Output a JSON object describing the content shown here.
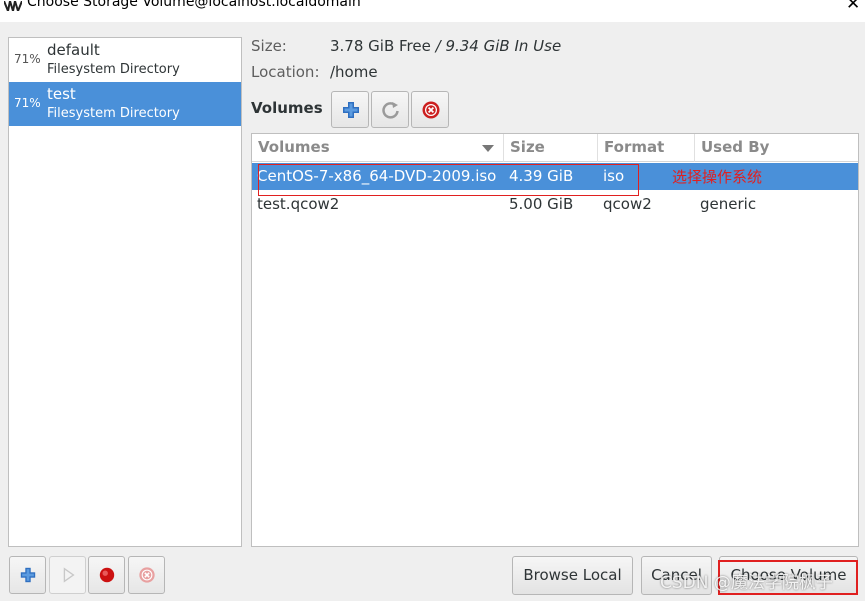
{
  "window": {
    "title": "Choose Storage Volume@localhost.localdomain",
    "close_icon": "close-icon"
  },
  "pools": [
    {
      "percent": "71%",
      "name": "default",
      "type": "Filesystem Directory",
      "selected": false
    },
    {
      "percent": "71%",
      "name": "test",
      "type": "Filesystem Directory",
      "selected": true
    }
  ],
  "pool_info": {
    "size_label": "Size:",
    "size_free": "3.78 GiB Free",
    "size_sep": " / ",
    "size_in_use": "9.34 GiB In Use",
    "location_label": "Location:",
    "location_value": "/home"
  },
  "volumes_toolbar": {
    "label": "Volumes",
    "buttons": [
      "add-volume",
      "refresh-volumes",
      "delete-volume"
    ]
  },
  "volumes_table": {
    "columns": [
      "Volumes",
      "Size",
      "Format",
      "Used By"
    ],
    "rows": [
      {
        "name": "CentOS-7-x86_64-DVD-2009.iso",
        "size": "4.39 GiB",
        "format": "iso",
        "used_by": "",
        "selected": true
      },
      {
        "name": "test.qcow2",
        "size": "5.00 GiB",
        "format": "qcow2",
        "used_by": "generic",
        "selected": false
      }
    ]
  },
  "annotation": {
    "text": "选择操作系统",
    "color": "#e02020"
  },
  "pool_toolbar": {
    "buttons": [
      "add-pool",
      "start-pool",
      "stop-pool",
      "delete-pool"
    ]
  },
  "actions": {
    "browse_local": "Browse Local",
    "cancel": "Cancel",
    "choose_volume": "Choose Volume"
  },
  "watermark": "CSDN @魔法学院枫子",
  "colors": {
    "selection": "#4a90d9",
    "annotation": "#e02020"
  }
}
